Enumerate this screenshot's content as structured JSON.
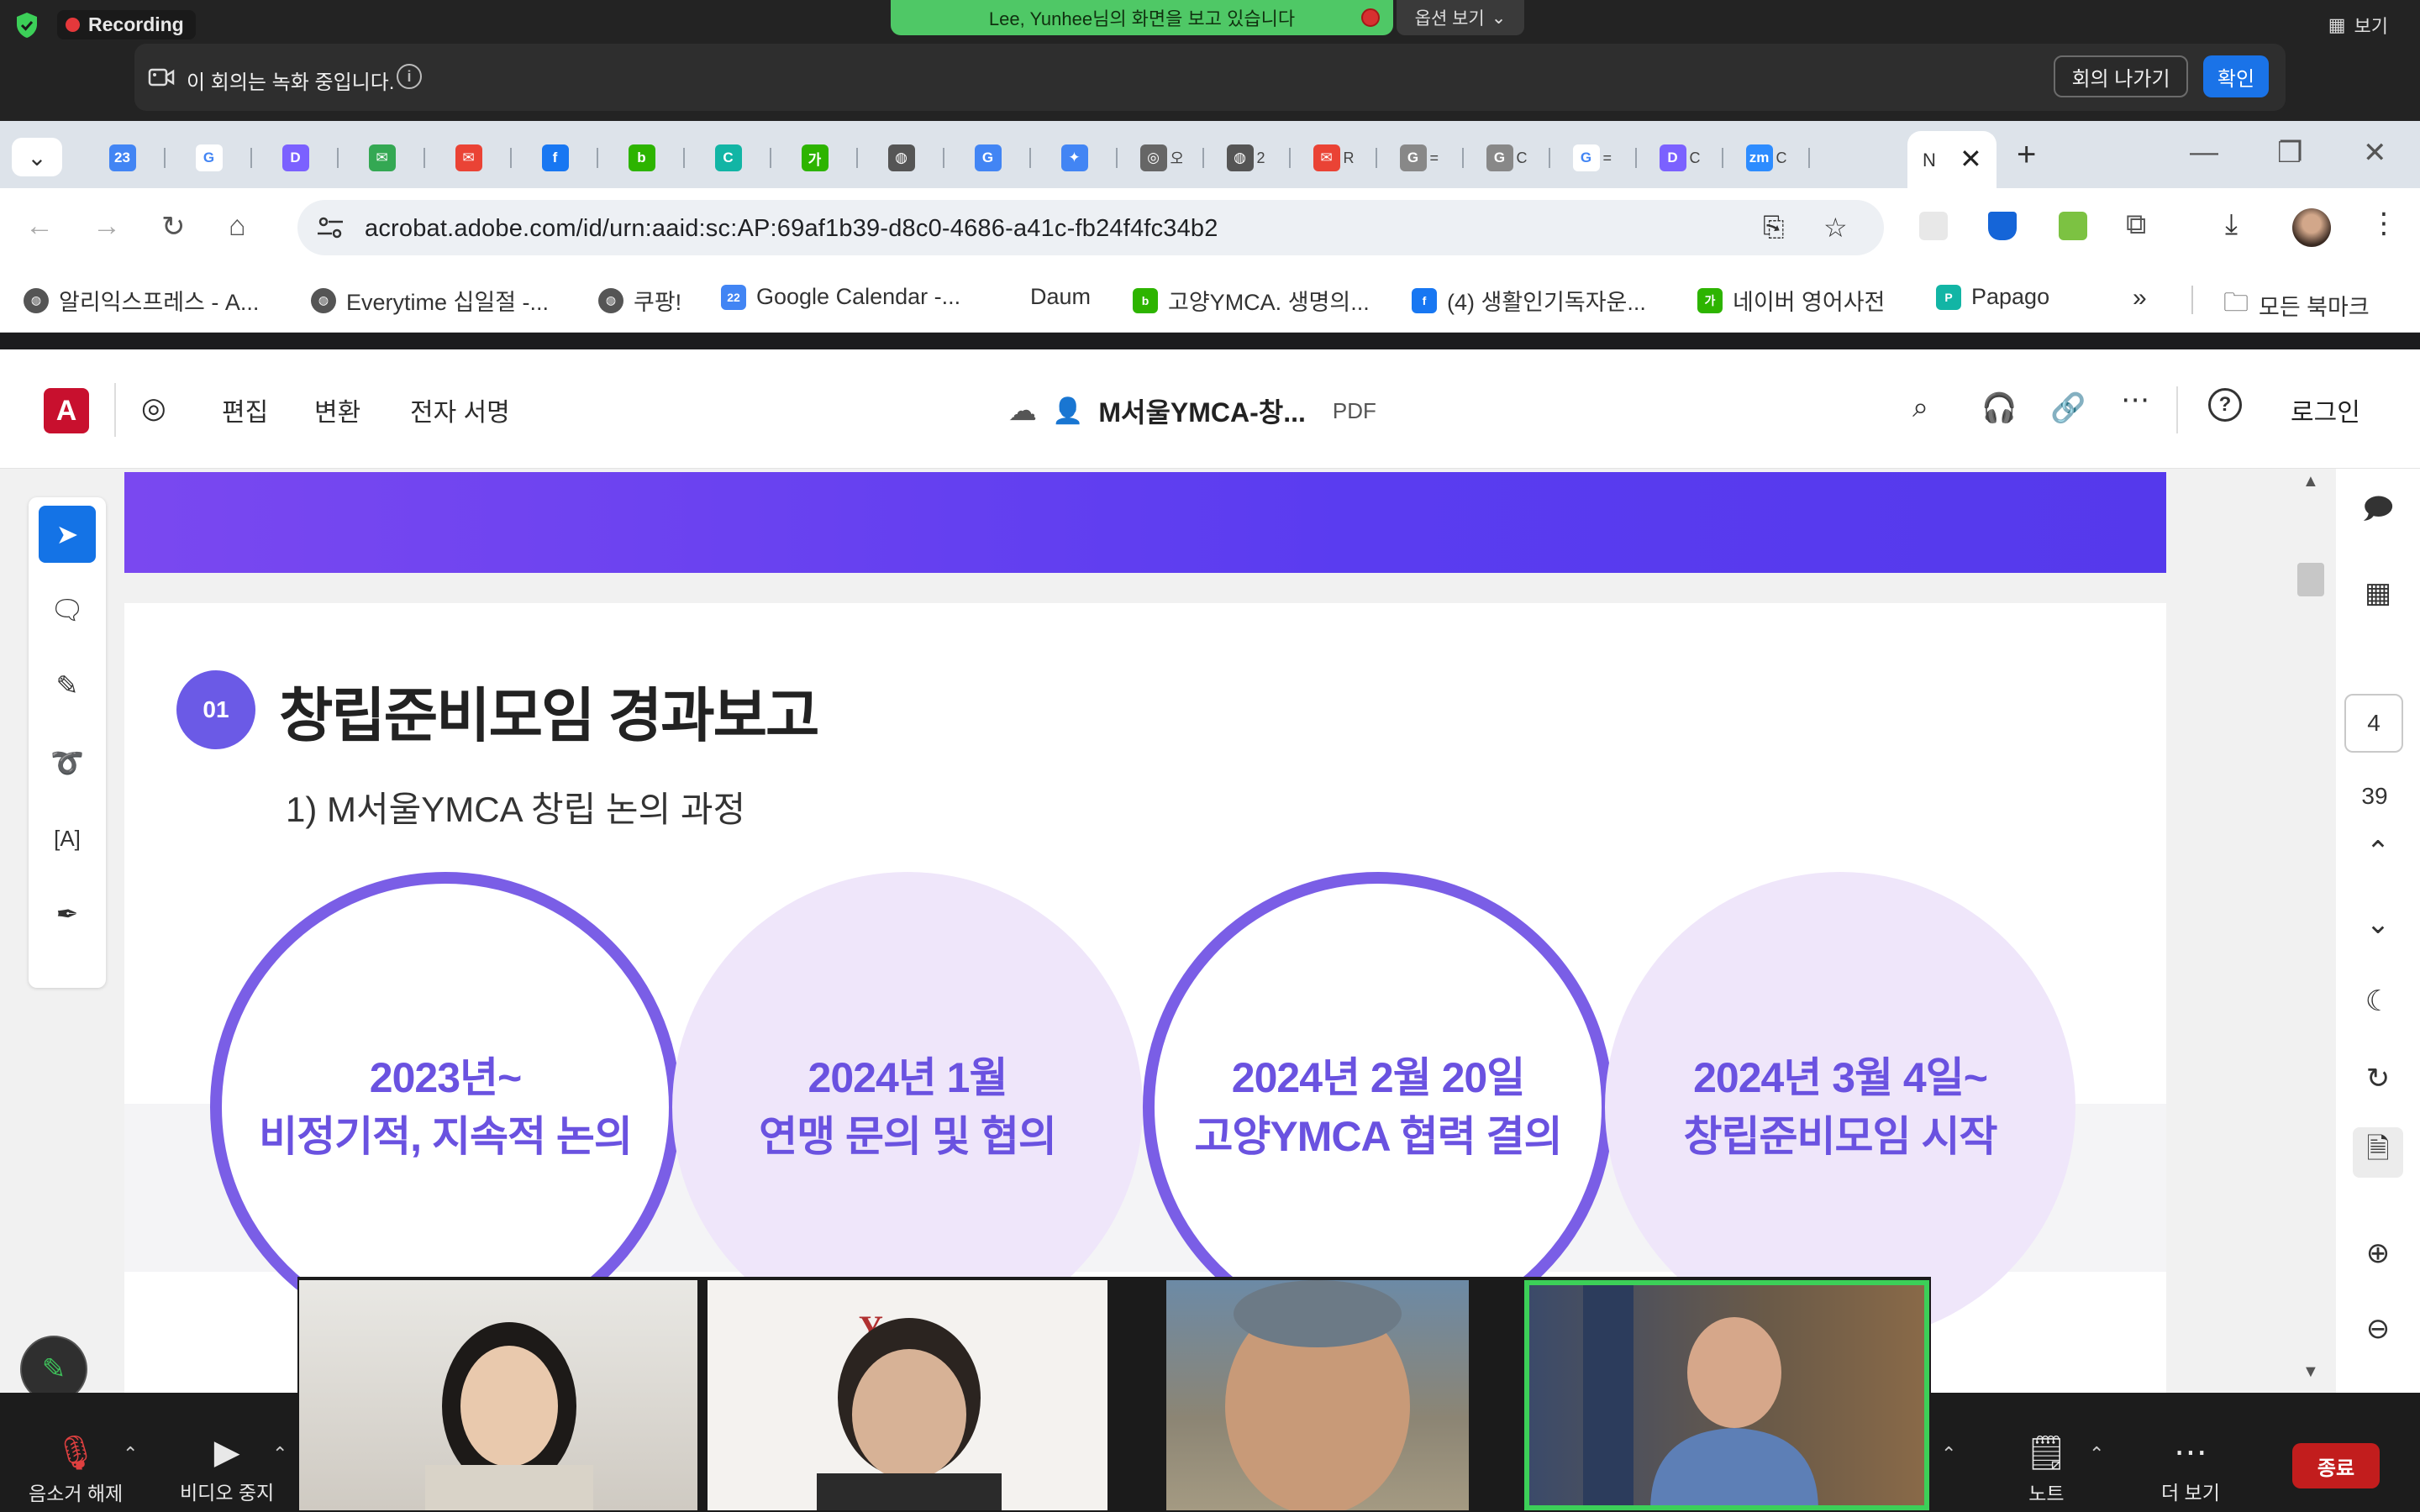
{
  "zoom": {
    "recording_label": "Recording",
    "share_banner": "Lee, Yunhee님의 화면을 보고 있습니다",
    "view_options": "옵션 보기",
    "view_button": "보기",
    "notice_text": "이 회의는 녹화 중입니다.",
    "leave_button": "회의 나가기",
    "confirm_button": "확인",
    "controls": {
      "mute": "음소거 해제",
      "video": "비디오 중지",
      "notes": "노트",
      "more": "더 보기",
      "end": "종료"
    }
  },
  "browser": {
    "tabs": [
      {
        "icon": "calendar-icon",
        "label": "",
        "color": "#4285f4",
        "glyph": "23"
      },
      {
        "icon": "google-icon",
        "label": "",
        "color": "#ffffff",
        "glyph": "G"
      },
      {
        "icon": "d-icon",
        "label": "",
        "color": "#7b61ff",
        "glyph": "D"
      },
      {
        "icon": "mail-icon",
        "label": "",
        "color": "#34a853",
        "glyph": "✉"
      },
      {
        "icon": "gmail-icon",
        "label": "",
        "color": "#ea4335",
        "glyph": "✉"
      },
      {
        "icon": "facebook-icon",
        "label": "",
        "color": "#1877f2",
        "glyph": "f"
      },
      {
        "icon": "blog-icon",
        "label": "",
        "color": "#2db400",
        "glyph": "b"
      },
      {
        "icon": "calendar-c-icon",
        "label": "",
        "color": "#12b5a5",
        "glyph": "C"
      },
      {
        "icon": "ga-icon",
        "label": "",
        "color": "#2db400",
        "glyph": "가"
      },
      {
        "icon": "globe-icon",
        "label": "",
        "color": "#555555",
        "glyph": "◍"
      },
      {
        "icon": "translate-icon",
        "label": "",
        "color": "#4285f4",
        "glyph": "G"
      },
      {
        "icon": "sparkle-icon",
        "label": "",
        "color": "#4285f4",
        "glyph": "✦"
      },
      {
        "icon": "search-icon",
        "label": "오",
        "color": "#666666",
        "glyph": "◎"
      },
      {
        "icon": "globe-icon",
        "label": "2",
        "color": "#555555",
        "glyph": "◍"
      },
      {
        "icon": "gmail-icon",
        "label": "R",
        "color": "#ea4335",
        "glyph": "✉"
      },
      {
        "icon": "google-lens-icon",
        "label": "=",
        "color": "#888888",
        "glyph": "G"
      },
      {
        "icon": "google-lens-icon",
        "label": "C",
        "color": "#888888",
        "glyph": "G"
      },
      {
        "icon": "google-icon",
        "label": "=",
        "color": "#ffffff",
        "glyph": "G"
      },
      {
        "icon": "d-icon",
        "label": "C",
        "color": "#7b61ff",
        "glyph": "D"
      },
      {
        "icon": "zoom-icon",
        "label": "C",
        "color": "#2d8cff",
        "glyph": "zm"
      }
    ],
    "active_tab_label": "N",
    "url": "acrobat.adobe.com/id/urn:aaid:sc:AP:69af1b39-d8c0-4686-a41c-fb24f4fc34b2",
    "bookmarks": [
      {
        "label": "알리익스프레스 - A...",
        "icon": "globe-icon",
        "color": "#555555",
        "glyph": "◍"
      },
      {
        "label": "Everytime 십일절 -...",
        "icon": "globe-icon",
        "color": "#555555",
        "glyph": "◍"
      },
      {
        "label": "쿠팡!",
        "icon": "globe-icon",
        "color": "#555555",
        "glyph": "◍"
      },
      {
        "label": "Google Calendar -...",
        "icon": "calendar-icon",
        "color": "#4285f4",
        "glyph": "22"
      },
      {
        "label": "Daum",
        "icon": "daum-icon",
        "color": "#ffffff",
        "glyph": ""
      },
      {
        "label": "고양YMCA. 생명의...",
        "icon": "blog-icon",
        "color": "#2db400",
        "glyph": "b"
      },
      {
        "label": "(4) 생활인기독자운...",
        "icon": "facebook-icon",
        "color": "#1877f2",
        "glyph": "f"
      },
      {
        "label": "네이버 영어사전",
        "icon": "naver-dict-icon",
        "color": "#2db400",
        "glyph": "가"
      },
      {
        "label": "Papago",
        "icon": "papago-icon",
        "color": "#12b5a5",
        "glyph": "P"
      }
    ],
    "all_bookmarks": "모든 북마크"
  },
  "acrobat": {
    "menu": [
      "편집",
      "변환",
      "전자 서명"
    ],
    "doc_title": "M서울YMCA-창...",
    "doc_type": "PDF",
    "login": "로그인",
    "page_current": "4",
    "page_total": "39"
  },
  "slide": {
    "section_number": "01",
    "section_title": "창립준비모임 경과보고",
    "subtitle": "1) M서울YMCA 창립 논의 과정",
    "milestones": [
      {
        "line1": "2023년~",
        "line2": "비정기적, 지속적 논의",
        "style": "ring"
      },
      {
        "line1": "2024년 1월",
        "line2": "연맹 문의 및 협의",
        "style": "fill"
      },
      {
        "line1": "2024년 2월 20일",
        "line2": "고양YMCA 협력 결의",
        "style": "ring"
      },
      {
        "line1": "2024년 3월 4일~",
        "line2": "창립준비모임 시작",
        "style": "fill"
      }
    ],
    "accent_color": "#6b5ae6"
  }
}
